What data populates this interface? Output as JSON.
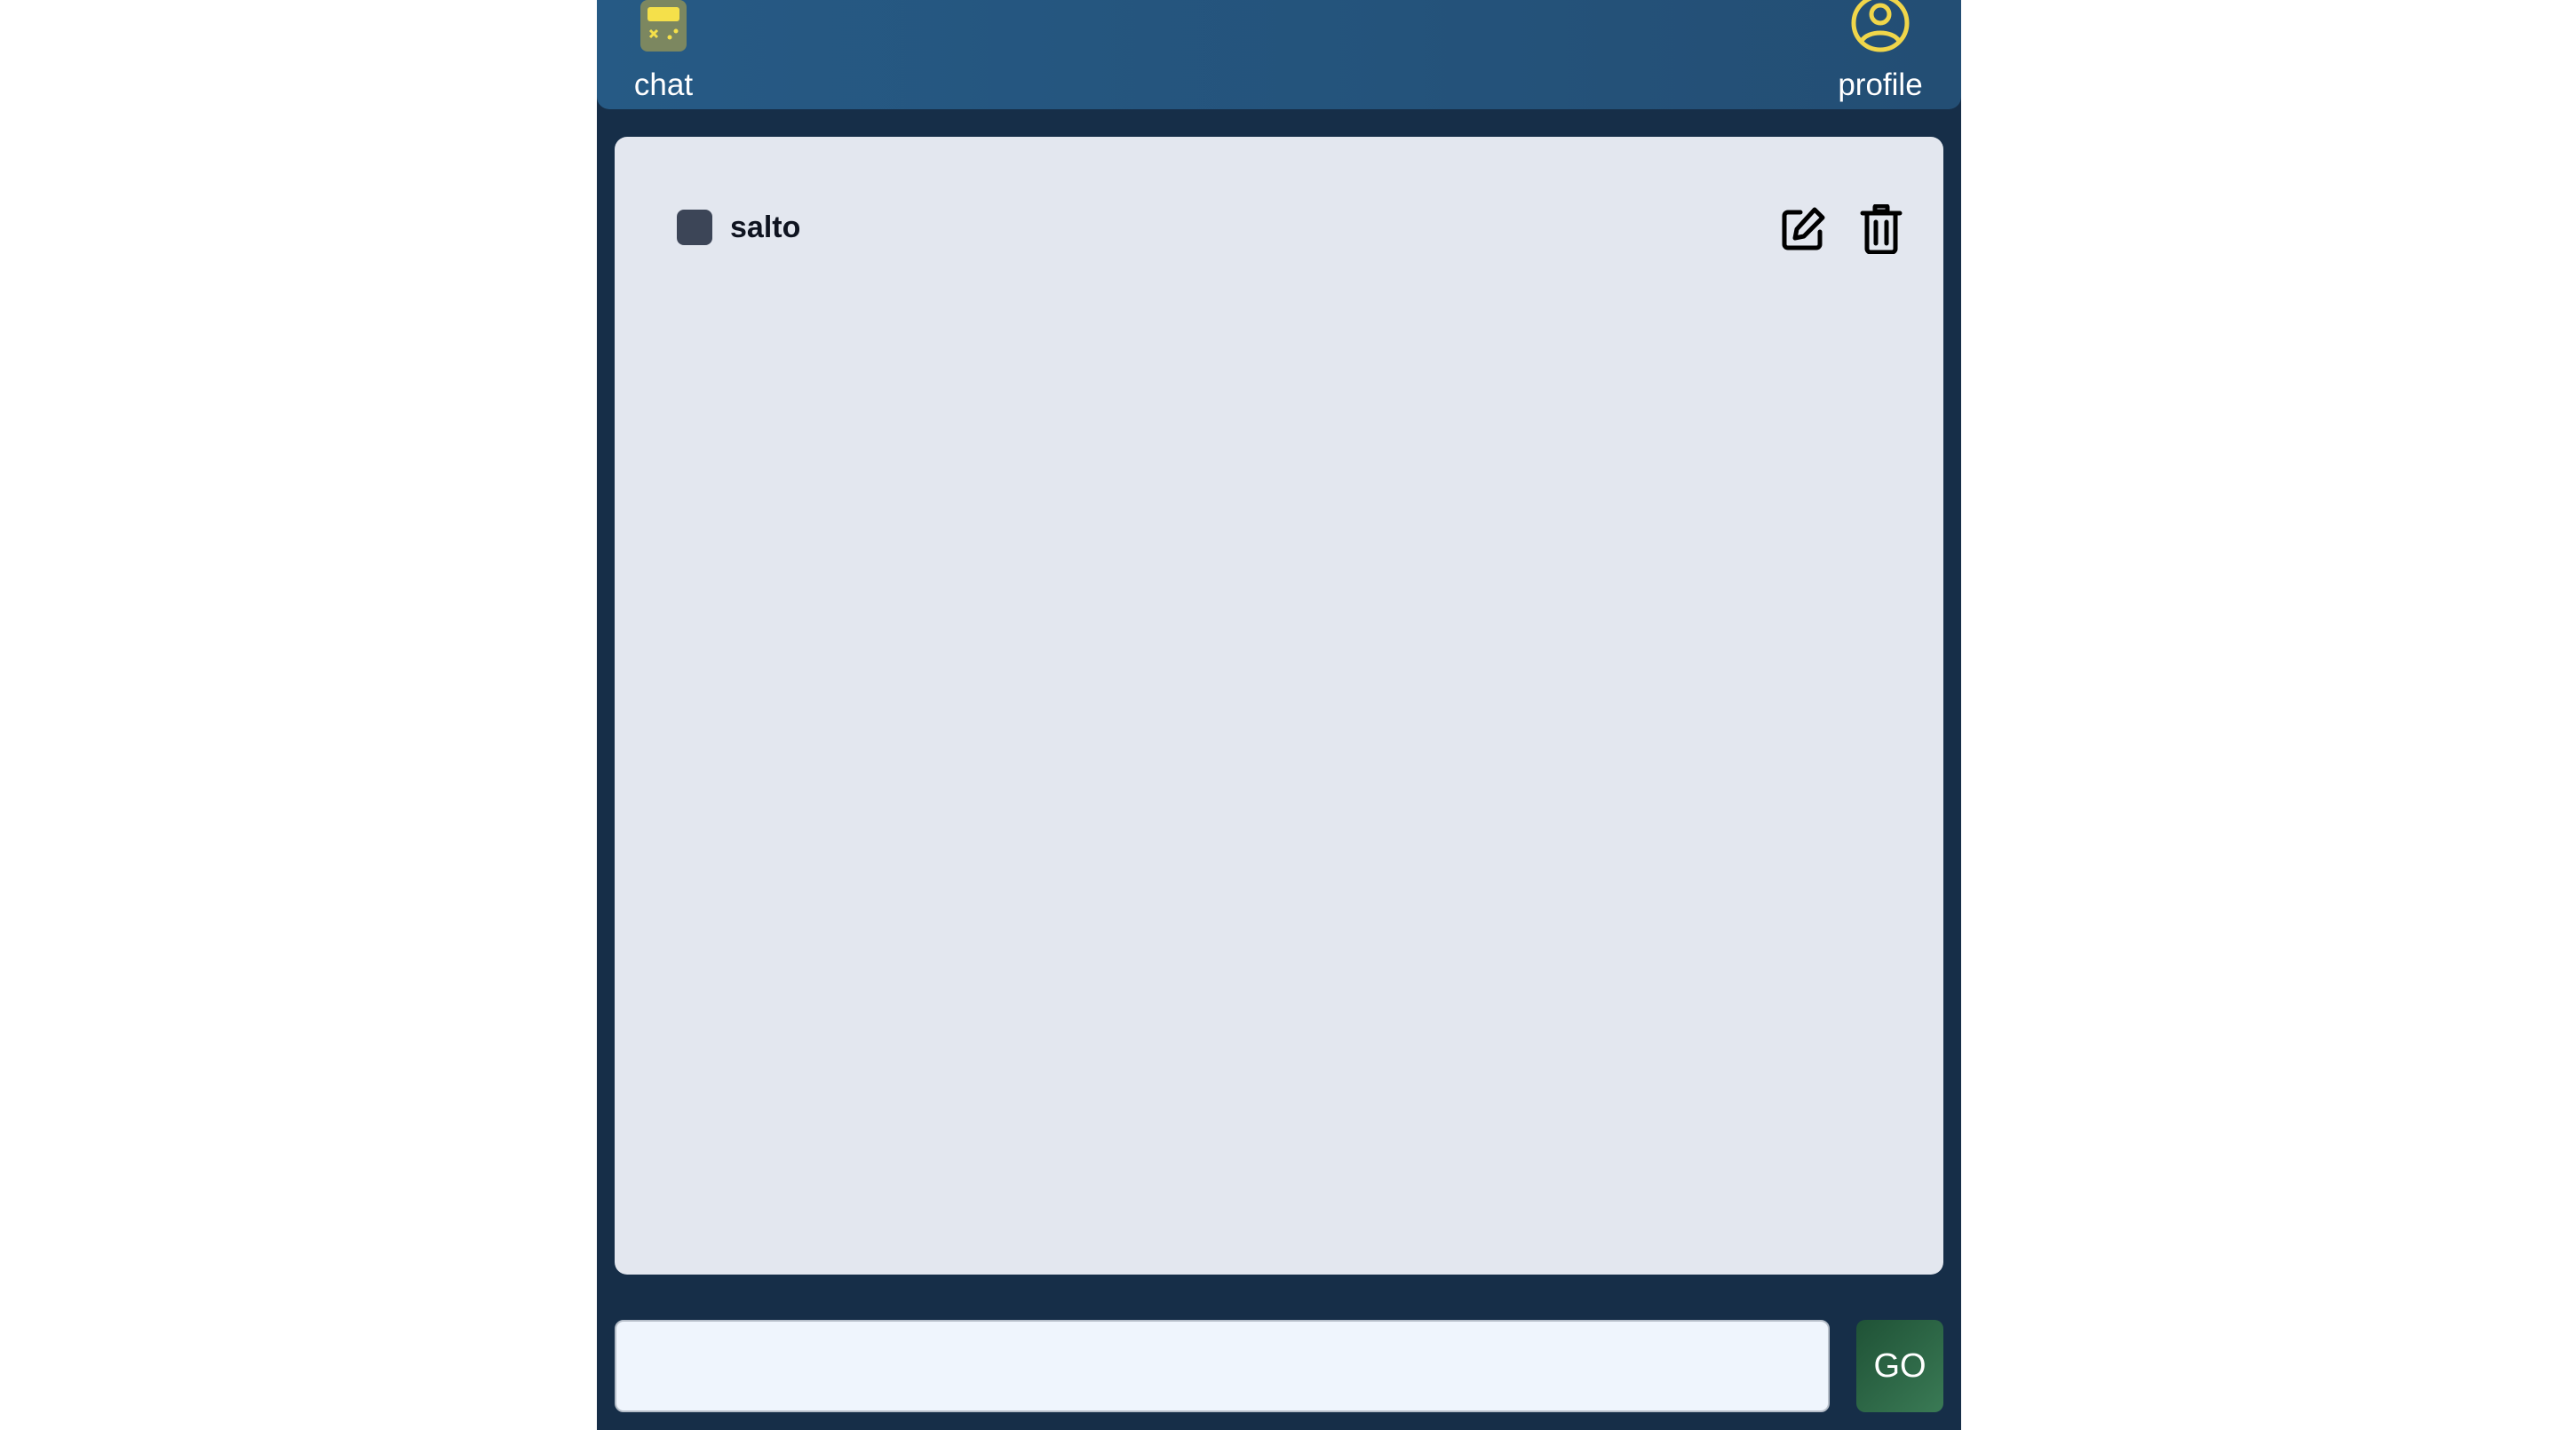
{
  "nav": {
    "chat_label": "chat",
    "profile_label": "profile",
    "chat_icon": "calculator-icon",
    "profile_icon": "user-circle-icon"
  },
  "todos": [
    {
      "label": "salto",
      "checked": false
    }
  ],
  "actions": {
    "edit_icon": "edit-icon",
    "delete_icon": "trash-icon"
  },
  "input": {
    "value": "",
    "placeholder": ""
  },
  "go_button": {
    "label": "GO"
  },
  "colors": {
    "background": "#162e48",
    "topbar": "#265a85",
    "panel": "#e3e7ef",
    "accent_yellow": "#f0d64a",
    "go_green": "#2d6a48"
  }
}
